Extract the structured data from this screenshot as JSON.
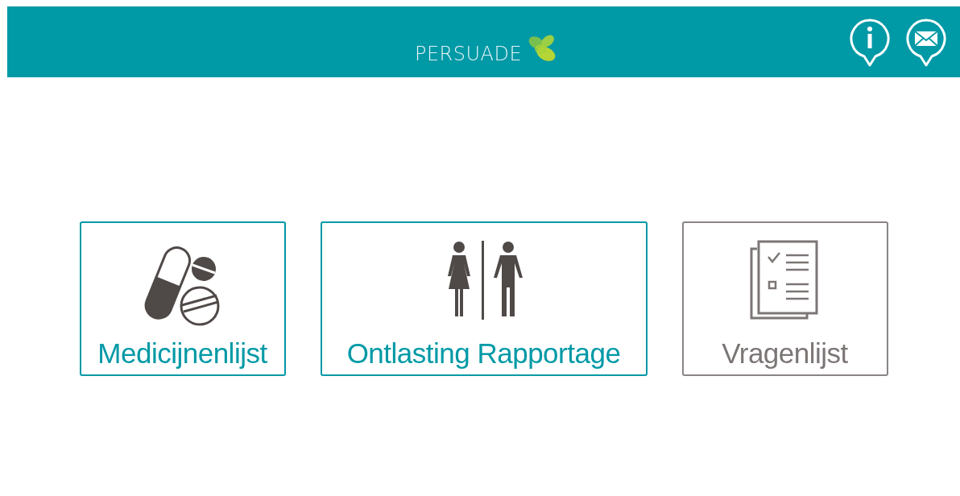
{
  "header": {
    "brand": "PERSUADE"
  },
  "tiles": [
    {
      "kind": "pills",
      "label": "Medicijnenlijst",
      "disabled": false
    },
    {
      "kind": "toilet",
      "label": "Ontlasting Rapportage",
      "disabled": false
    },
    {
      "kind": "questionnaire",
      "label": "Vragenlijst",
      "disabled": true
    }
  ]
}
